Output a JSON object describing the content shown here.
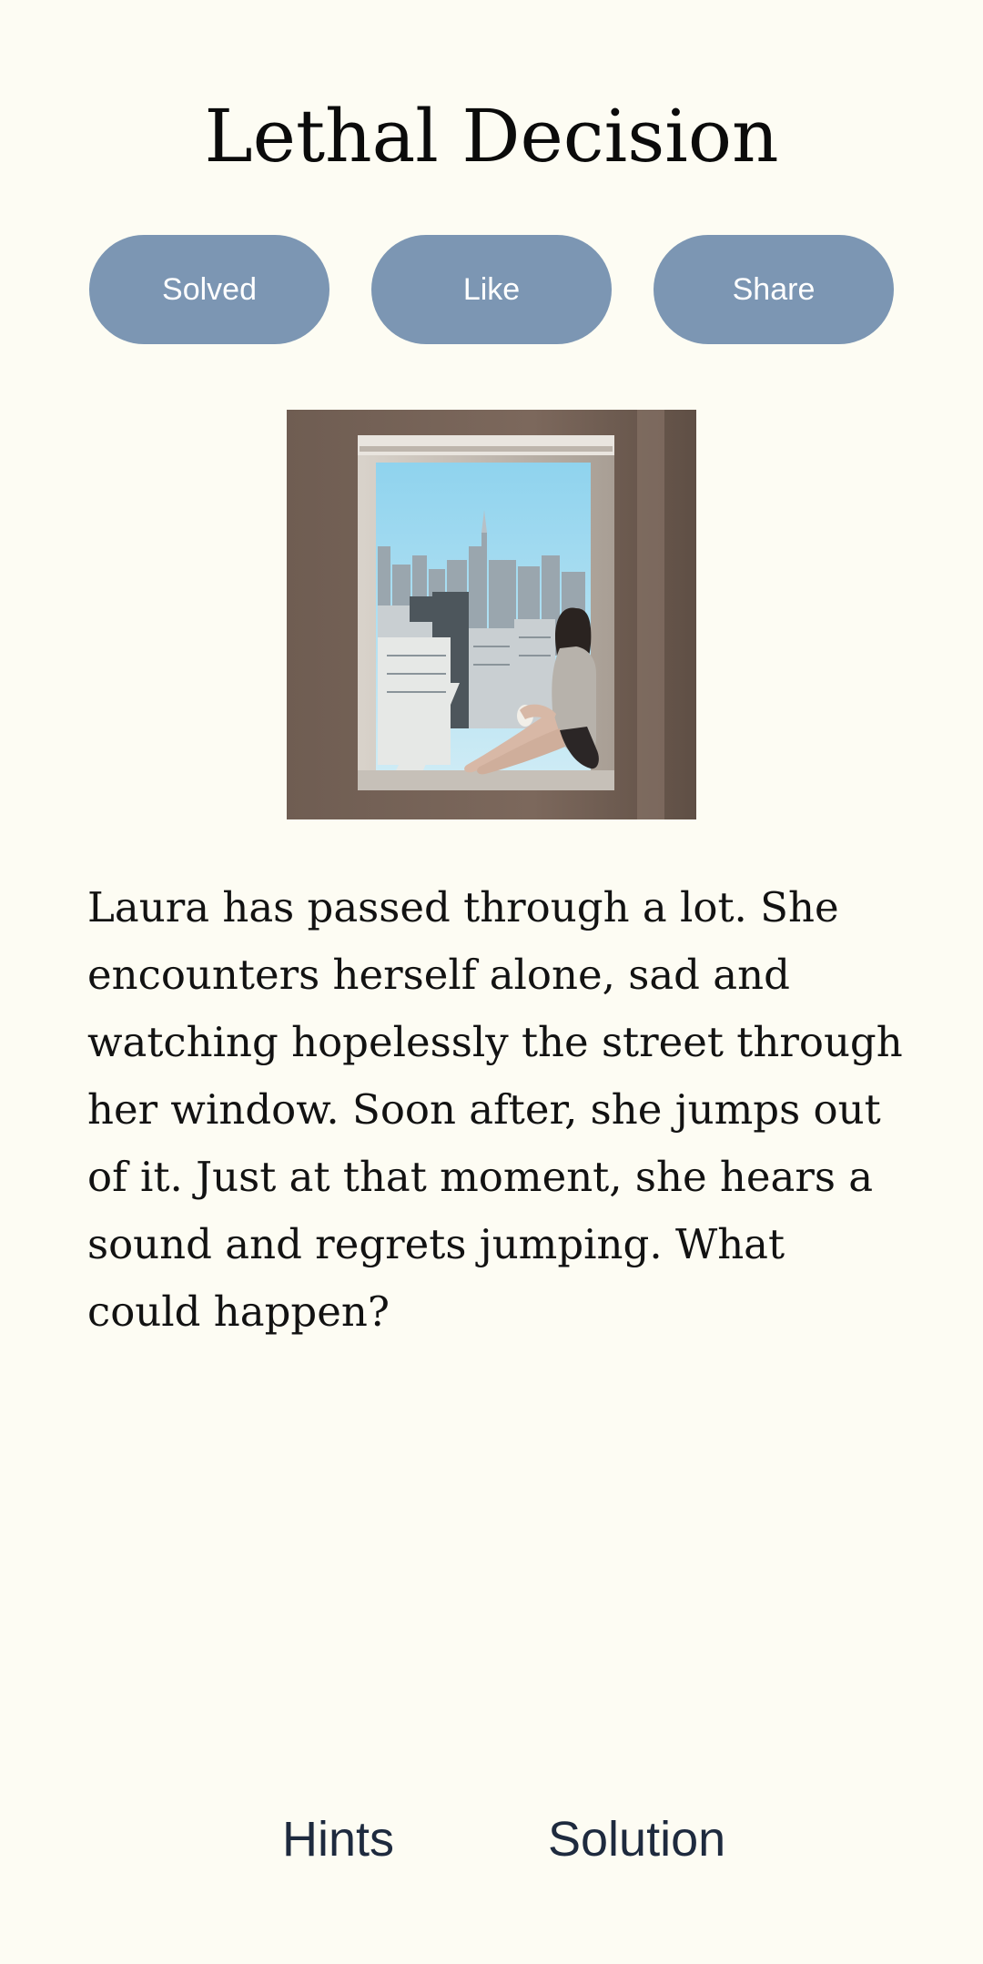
{
  "puzzle": {
    "title": "Lethal Decision",
    "story": "Laura has passed through a lot. She encounters herself alone, sad and watching hopelessly the street through her window. Soon after, she jumps out of it. Just at that moment, she hears a sound and regrets jumping. What could happen?"
  },
  "actions": {
    "solved_label": "Solved",
    "like_label": "Like",
    "share_label": "Share"
  },
  "footer": {
    "hints_label": "Hints",
    "solution_label": "Solution"
  },
  "colors": {
    "background": "#FDFCF3",
    "button": "#7C96B3",
    "footer_text": "#1E2A3E"
  }
}
